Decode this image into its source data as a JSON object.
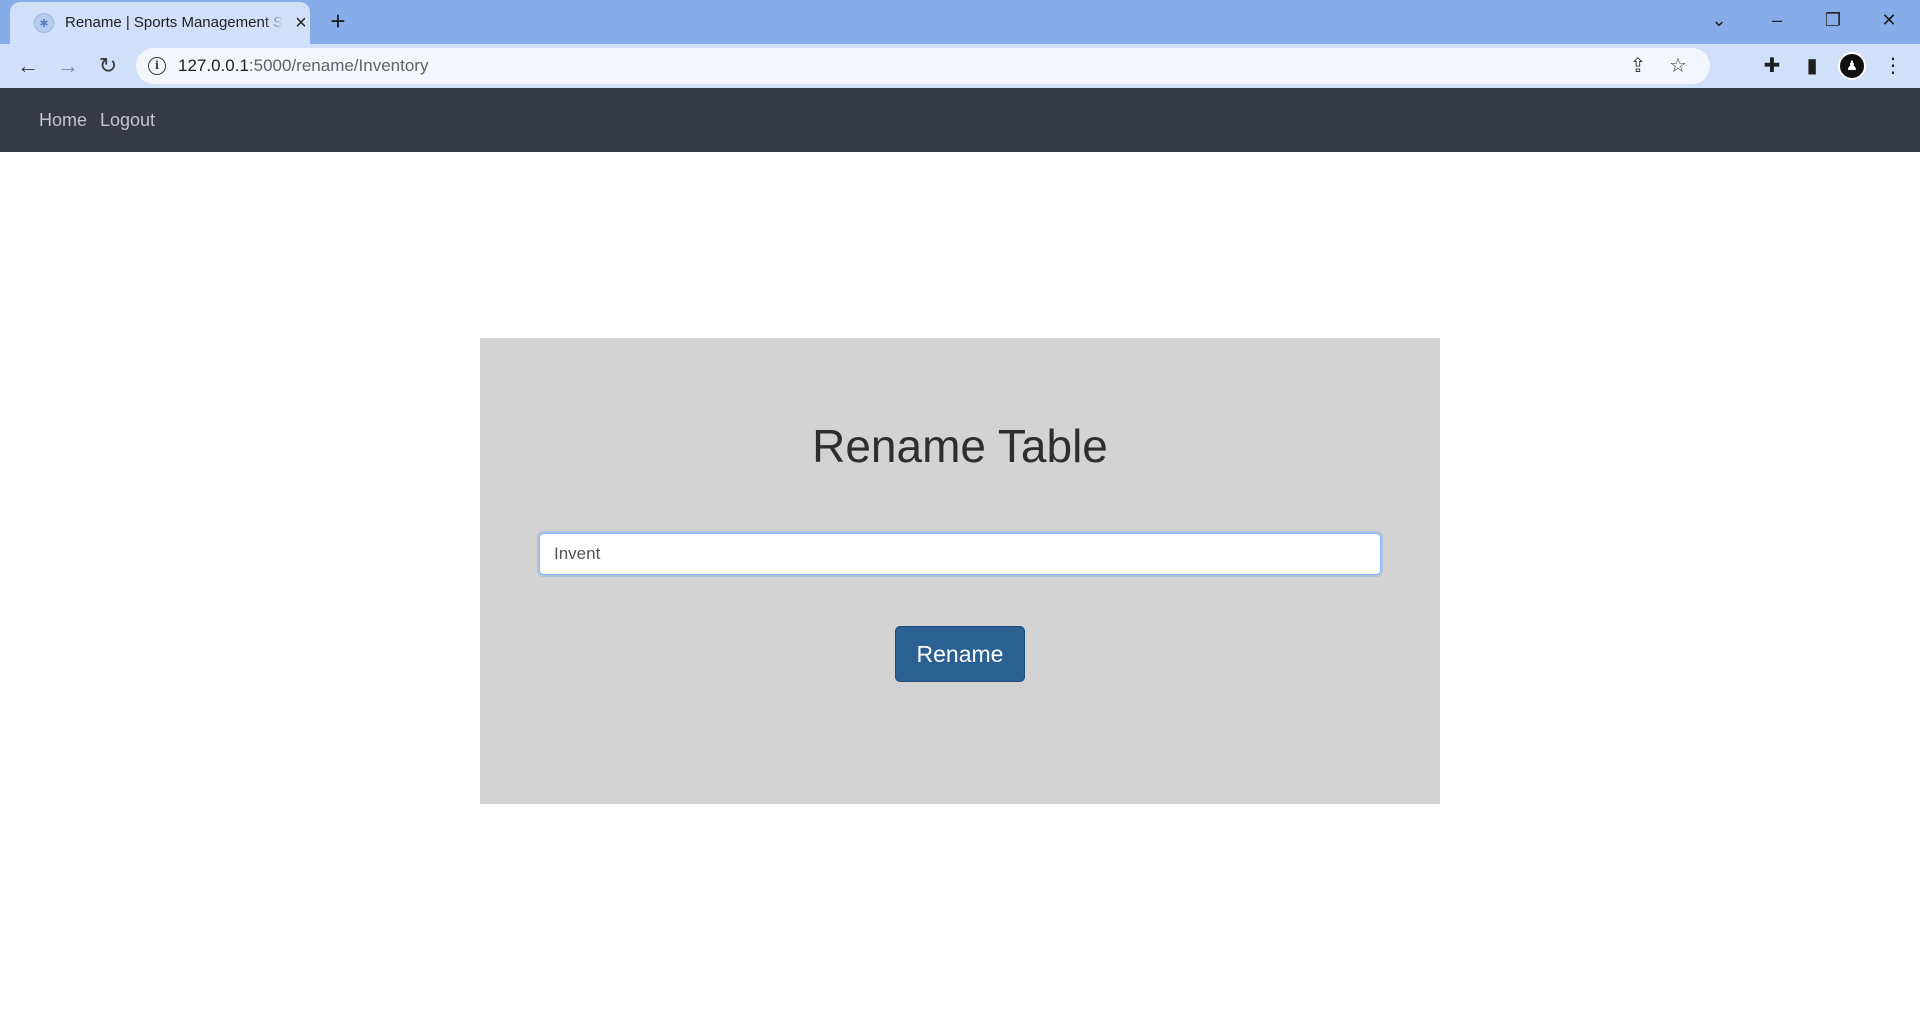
{
  "browser": {
    "tab_title": "Rename | Sports Management System",
    "new_tab_label": "+",
    "url_host": "127.0.0.1",
    "url_path": ":5000/rename/Inventory",
    "icons": {
      "favicon": "favicon-icon",
      "close": "close-icon",
      "back": "back-arrow-icon",
      "forward": "forward-arrow-icon",
      "reload": "reload-icon",
      "site_info": "info-icon",
      "share": "share-icon",
      "bookmark": "star-icon",
      "extensions": "puzzle-icon",
      "side_panel": "side-panel-icon",
      "profile": "avatar",
      "menu": "kebab-menu-icon",
      "tab_search": "chevron-down-icon",
      "minimize": "minimize-icon",
      "restore": "restore-icon",
      "window_close": "close-icon"
    }
  },
  "nav": {
    "home": "Home",
    "logout": "Logout"
  },
  "form": {
    "title": "Rename Table",
    "input_value": "Invent",
    "submit_label": "Rename"
  },
  "colors": {
    "navbar_bg": "#353a44",
    "card_bg": "#d3d3d3",
    "button_bg": "#2b6093",
    "browser_frame": "#86acea"
  }
}
